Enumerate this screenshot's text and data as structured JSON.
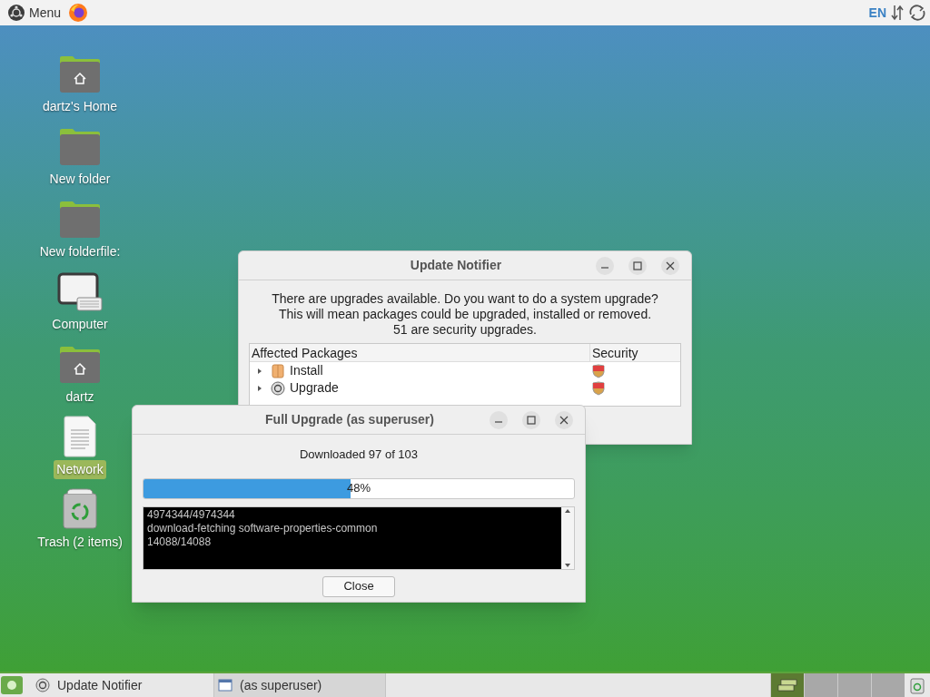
{
  "top_panel": {
    "menu_label": "Menu",
    "keyboard_layout": "EN"
  },
  "desktop_icons": [
    {
      "kind": "home",
      "label": "dartz's Home",
      "selected": false
    },
    {
      "kind": "folder",
      "label": "New folder",
      "selected": false
    },
    {
      "kind": "folder",
      "label": "New folderfile:",
      "selected": false
    },
    {
      "kind": "computer",
      "label": "Computer",
      "selected": false
    },
    {
      "kind": "home",
      "label": "dartz",
      "selected": false
    },
    {
      "kind": "file",
      "label": "Network",
      "selected": true
    },
    {
      "kind": "trash",
      "label": "Trash (2 items)",
      "selected": false
    }
  ],
  "update_notifier": {
    "title": "Update Notifier",
    "message": [
      "There are upgrades available. Do you want to do a system upgrade?",
      "This will mean packages could be upgraded, installed or removed.",
      "51 are security upgrades."
    ],
    "columns": [
      "Affected Packages",
      "Security"
    ],
    "rows": [
      {
        "kind": "install",
        "label": "Install",
        "expanded": false
      },
      {
        "kind": "upgrade",
        "label": "Upgrade",
        "expanded": false
      }
    ]
  },
  "full_upgrade": {
    "title": "Full Upgrade (as superuser)",
    "status": "Downloaded 97 of 103",
    "progress": {
      "level": 0.48,
      "reading": "48%"
    },
    "log": [
      "4974344/4974344",
      "download-fetching software-properties-common",
      "14088/14088"
    ],
    "button": "Close"
  },
  "taskbar": {
    "tasks": [
      {
        "kind": "upgrade",
        "label": "Update Notifier",
        "selected": false
      },
      {
        "kind": "window",
        "label": "(as superuser)",
        "selected": true
      }
    ],
    "workspaces": [
      {
        "selected": true
      },
      {
        "selected": false
      },
      {
        "selected": false
      },
      {
        "selected": false
      }
    ]
  }
}
